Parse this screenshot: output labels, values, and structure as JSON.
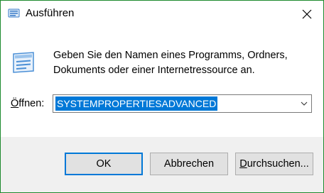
{
  "window": {
    "title": "Ausführen",
    "accent_border": "#1e8a2e"
  },
  "dialog": {
    "description": "Geben Sie den Namen eines Programms, Ordners, Dokuments oder einer Internetressource an.",
    "open_label_prefix": "Ö",
    "open_label_rest": "ffnen:",
    "input_value": "SYSTEMPROPERTIESADVANCED",
    "selection_color": "#0078d7"
  },
  "buttons": {
    "ok": "OK",
    "cancel": "Abbrechen",
    "browse_prefix": "D",
    "browse_rest": "urchsuchen..."
  },
  "icons": {
    "title": "run-app-icon",
    "large": "run-app-icon",
    "close": "close-icon",
    "dropdown": "chevron-down-icon"
  }
}
